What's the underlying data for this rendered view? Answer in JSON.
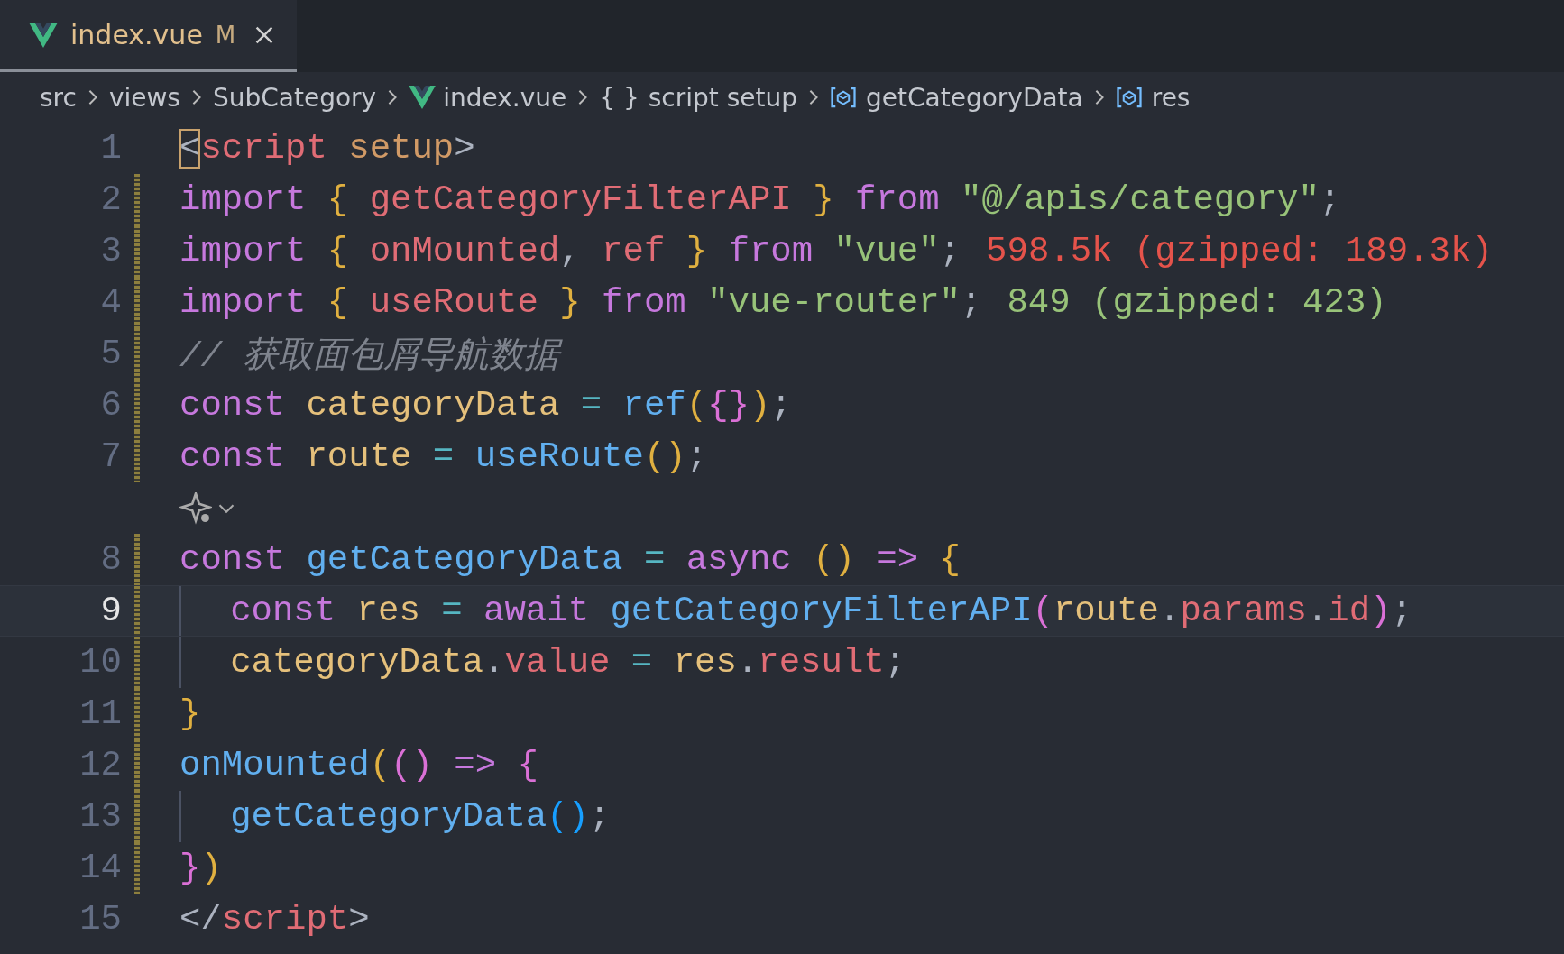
{
  "tab": {
    "label": "index.vue",
    "status": "M",
    "selected": true
  },
  "breadcrumbs": [
    {
      "kind": "folder",
      "label": "src"
    },
    {
      "kind": "folder",
      "label": "views"
    },
    {
      "kind": "folder",
      "label": "SubCategory"
    },
    {
      "kind": "vue",
      "label": "index.vue"
    },
    {
      "kind": "scope",
      "symbol": "{ }",
      "label": "script setup"
    },
    {
      "kind": "variable",
      "label": "getCategoryData"
    },
    {
      "kind": "variable",
      "label": "res"
    }
  ],
  "lines": [
    {
      "kind": "code",
      "number": "1",
      "modified": false,
      "current": false,
      "indent": false,
      "tokens": [
        {
          "kind": "tagp",
          "text": "<",
          "matched": true
        },
        {
          "kind": "tag",
          "text": "script"
        },
        {
          "kind": "attr",
          "text": " setup"
        },
        {
          "kind": "tagp",
          "text": ">"
        }
      ]
    },
    {
      "kind": "code",
      "number": "2",
      "modified": true,
      "current": false,
      "indent": false,
      "tokens": [
        {
          "kind": "kw",
          "text": "import"
        },
        {
          "kind": "b1",
          "text": " {"
        },
        {
          "kind": "var",
          "text": " getCategoryFilterAPI"
        },
        {
          "kind": "b1",
          "text": " }"
        },
        {
          "kind": "kw",
          "text": " from"
        },
        {
          "kind": "str",
          "text": " \"@/apis/category\""
        },
        {
          "kind": "punc",
          "text": ";"
        }
      ]
    },
    {
      "kind": "code",
      "number": "3",
      "modified": true,
      "current": false,
      "indent": false,
      "tokens": [
        {
          "kind": "kw",
          "text": "import"
        },
        {
          "kind": "b1",
          "text": " {"
        },
        {
          "kind": "var",
          "text": " onMounted"
        },
        {
          "kind": "punc",
          "text": ","
        },
        {
          "kind": "var",
          "text": " ref"
        },
        {
          "kind": "b1",
          "text": " }"
        },
        {
          "kind": "kw",
          "text": " from"
        },
        {
          "kind": "str",
          "text": " \"vue\""
        },
        {
          "kind": "punc",
          "text": ";"
        }
      ],
      "import_cost": {
        "text": "598.5k (gzipped: 189.3k)",
        "color": "#e5534b"
      }
    },
    {
      "kind": "code",
      "number": "4",
      "modified": true,
      "current": false,
      "indent": false,
      "tokens": [
        {
          "kind": "kw",
          "text": "import"
        },
        {
          "kind": "b1",
          "text": " {"
        },
        {
          "kind": "var",
          "text": " useRoute"
        },
        {
          "kind": "b1",
          "text": " }"
        },
        {
          "kind": "kw",
          "text": " from"
        },
        {
          "kind": "str",
          "text": " \"vue-router\""
        },
        {
          "kind": "punc",
          "text": ";"
        }
      ],
      "import_cost": {
        "text": "849 (gzipped: 423)",
        "color": "#98c379"
      }
    },
    {
      "kind": "code",
      "number": "5",
      "modified": true,
      "current": false,
      "indent": false,
      "tokens": [
        {
          "kind": "comment",
          "text": "// 获取面包屑导航数据"
        }
      ]
    },
    {
      "kind": "code",
      "number": "6",
      "modified": true,
      "current": false,
      "indent": false,
      "tokens": [
        {
          "kind": "kw",
          "text": "const"
        },
        {
          "kind": "const",
          "text": " categoryData"
        },
        {
          "kind": "op",
          "text": " ="
        },
        {
          "kind": "fn",
          "text": " ref"
        },
        {
          "kind": "b1",
          "text": "("
        },
        {
          "kind": "b2",
          "text": "{}"
        },
        {
          "kind": "b1",
          "text": ")"
        },
        {
          "kind": "punc",
          "text": ";"
        }
      ]
    },
    {
      "kind": "code",
      "number": "7",
      "modified": true,
      "current": false,
      "indent": false,
      "tokens": [
        {
          "kind": "kw",
          "text": "const"
        },
        {
          "kind": "const",
          "text": " route"
        },
        {
          "kind": "op",
          "text": " ="
        },
        {
          "kind": "fn",
          "text": " useRoute"
        },
        {
          "kind": "b1",
          "text": "()"
        },
        {
          "kind": "punc",
          "text": ";"
        }
      ]
    },
    {
      "kind": "codelens"
    },
    {
      "kind": "code",
      "number": "8",
      "modified": true,
      "current": false,
      "indent": false,
      "tokens": [
        {
          "kind": "kw",
          "text": "const"
        },
        {
          "kind": "fn",
          "text": " getCategoryData"
        },
        {
          "kind": "op",
          "text": " ="
        },
        {
          "kind": "kw",
          "text": " async"
        },
        {
          "kind": "b1",
          "text": " ()"
        },
        {
          "kind": "kw",
          "text": " =>"
        },
        {
          "kind": "b1",
          "text": " {"
        }
      ]
    },
    {
      "kind": "code",
      "number": "9",
      "modified": true,
      "current": true,
      "indent": true,
      "tokens": [
        {
          "kind": "kw",
          "text": "const"
        },
        {
          "kind": "const",
          "text": " res"
        },
        {
          "kind": "op",
          "text": " ="
        },
        {
          "kind": "kw",
          "text": " await"
        },
        {
          "kind": "fn",
          "text": " getCategoryFilterAPI"
        },
        {
          "kind": "b2",
          "text": "("
        },
        {
          "kind": "const",
          "text": "route"
        },
        {
          "kind": "punc",
          "text": "."
        },
        {
          "kind": "var",
          "text": "params"
        },
        {
          "kind": "punc",
          "text": "."
        },
        {
          "kind": "var",
          "text": "id"
        },
        {
          "kind": "b2",
          "text": ")"
        },
        {
          "kind": "punc",
          "text": ";"
        }
      ]
    },
    {
      "kind": "code",
      "number": "10",
      "modified": true,
      "current": false,
      "indent": true,
      "tokens": [
        {
          "kind": "const",
          "text": "categoryData"
        },
        {
          "kind": "punc",
          "text": "."
        },
        {
          "kind": "var",
          "text": "value"
        },
        {
          "kind": "op",
          "text": " ="
        },
        {
          "kind": "const",
          "text": " res"
        },
        {
          "kind": "punc",
          "text": "."
        },
        {
          "kind": "var",
          "text": "result"
        },
        {
          "kind": "punc",
          "text": ";"
        }
      ]
    },
    {
      "kind": "code",
      "number": "11",
      "modified": true,
      "current": false,
      "indent": false,
      "tokens": [
        {
          "kind": "b1",
          "text": "}"
        }
      ]
    },
    {
      "kind": "code",
      "number": "12",
      "modified": true,
      "current": false,
      "indent": false,
      "tokens": [
        {
          "kind": "fn",
          "text": "onMounted"
        },
        {
          "kind": "b1",
          "text": "("
        },
        {
          "kind": "b2",
          "text": "()"
        },
        {
          "kind": "kw",
          "text": " =>"
        },
        {
          "kind": "b2",
          "text": " {"
        }
      ]
    },
    {
      "kind": "code",
      "number": "13",
      "modified": true,
      "current": false,
      "indent": true,
      "tokens": [
        {
          "kind": "fn",
          "text": "getCategoryData"
        },
        {
          "kind": "b3",
          "text": "()"
        },
        {
          "kind": "punc",
          "text": ";"
        }
      ]
    },
    {
      "kind": "code",
      "number": "14",
      "modified": true,
      "current": false,
      "indent": false,
      "tokens": [
        {
          "kind": "b2",
          "text": "}"
        },
        {
          "kind": "b1",
          "text": ")"
        }
      ]
    },
    {
      "kind": "code",
      "number": "15",
      "modified": false,
      "current": false,
      "indent": false,
      "tokens": [
        {
          "kind": "tagp",
          "text": "</"
        },
        {
          "kind": "tag",
          "text": "script"
        },
        {
          "kind": "tagp",
          "text": ">"
        }
      ]
    }
  ]
}
